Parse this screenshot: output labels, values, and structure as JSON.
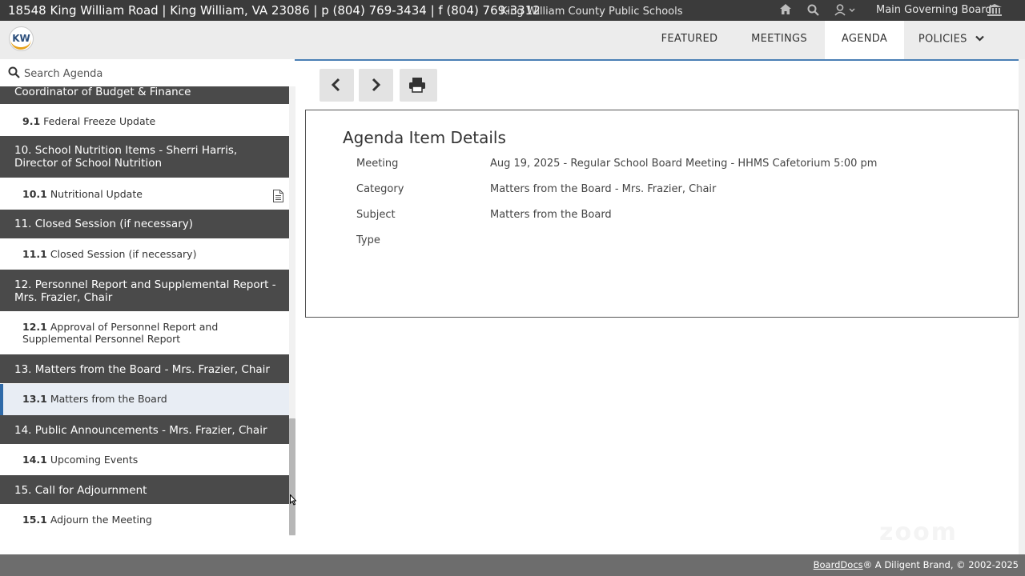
{
  "topbar": {
    "address": "18548 King William Road | King William, VA 23086 | p (804) 769-3434 | f (804) 769-3312",
    "org": "King William County Public Schools",
    "board": "Main Governing Board",
    "icons": [
      "home-icon",
      "search-icon",
      "user-icon",
      "building-icon"
    ]
  },
  "nav": {
    "logo_text": "KW",
    "featured": "FEATURED",
    "meetings": "MEETINGS",
    "agenda": "AGENDA",
    "policies": "POLICIES",
    "active": "AGENDA"
  },
  "sidebar": {
    "search_placeholder": "Search Agenda",
    "entries": [
      {
        "type": "cat",
        "lines": [
          "Coordinator of Budget & Finance"
        ]
      },
      {
        "type": "item",
        "num": "9.1",
        "text": "Federal Freeze Update"
      },
      {
        "type": "cat",
        "lines": [
          "10. School Nutrition Items - Sherri Harris,",
          "Director of School Nutrition"
        ]
      },
      {
        "type": "item",
        "num": "10.1",
        "text": "Nutritional Update",
        "has_doc": true
      },
      {
        "type": "cat",
        "lines": [
          "11. Closed Session (if necessary)"
        ]
      },
      {
        "type": "item",
        "num": "11.1",
        "text": "Closed Session (if necessary)"
      },
      {
        "type": "cat",
        "lines": [
          "12. Personnel Report and Supplemental Report -",
          "Mrs. Frazier, Chair"
        ]
      },
      {
        "type": "item",
        "num": "12.1",
        "text": "Approval of Personnel Report and",
        "text2": "Supplemental Personnel Report"
      },
      {
        "type": "cat",
        "lines": [
          "13. Matters from the Board - Mrs. Frazier, Chair"
        ]
      },
      {
        "type": "item",
        "num": "13.1",
        "text": "Matters from the Board",
        "selected": true
      },
      {
        "type": "cat",
        "lines": [
          "14. Public Announcements - Mrs. Frazier, Chair"
        ]
      },
      {
        "type": "item",
        "num": "14.1",
        "text": "Upcoming Events"
      },
      {
        "type": "cat",
        "lines": [
          "15. Call for Adjournment"
        ]
      },
      {
        "type": "item",
        "num": "15.1",
        "text": "Adjourn the Meeting"
      }
    ]
  },
  "details": {
    "title": "Agenda Item Details",
    "meeting_label": "Meeting",
    "meeting_value": "Aug 19, 2025 - Regular School Board Meeting - HHMS Cafetorium 5:00 pm",
    "category_label": "Category",
    "category_value": "Matters from the Board - Mrs. Frazier, Chair",
    "subject_label": "Subject",
    "subject_value": "Matters from the Board",
    "type_label": "Type",
    "type_value": ""
  },
  "toolbar": {
    "icons": [
      "chevron-left-icon",
      "chevron-right-icon",
      "print-icon"
    ]
  },
  "watermark": "zoom",
  "footer": {
    "brand": "BoardDocs",
    "rest": "® A Diligent Brand, © 2002-2025"
  },
  "colors": {
    "topbar": "#3b3b3b",
    "category_bg": "#4a4a4a",
    "accent": "#4a7fb5",
    "footer": "#6d6d6d"
  }
}
